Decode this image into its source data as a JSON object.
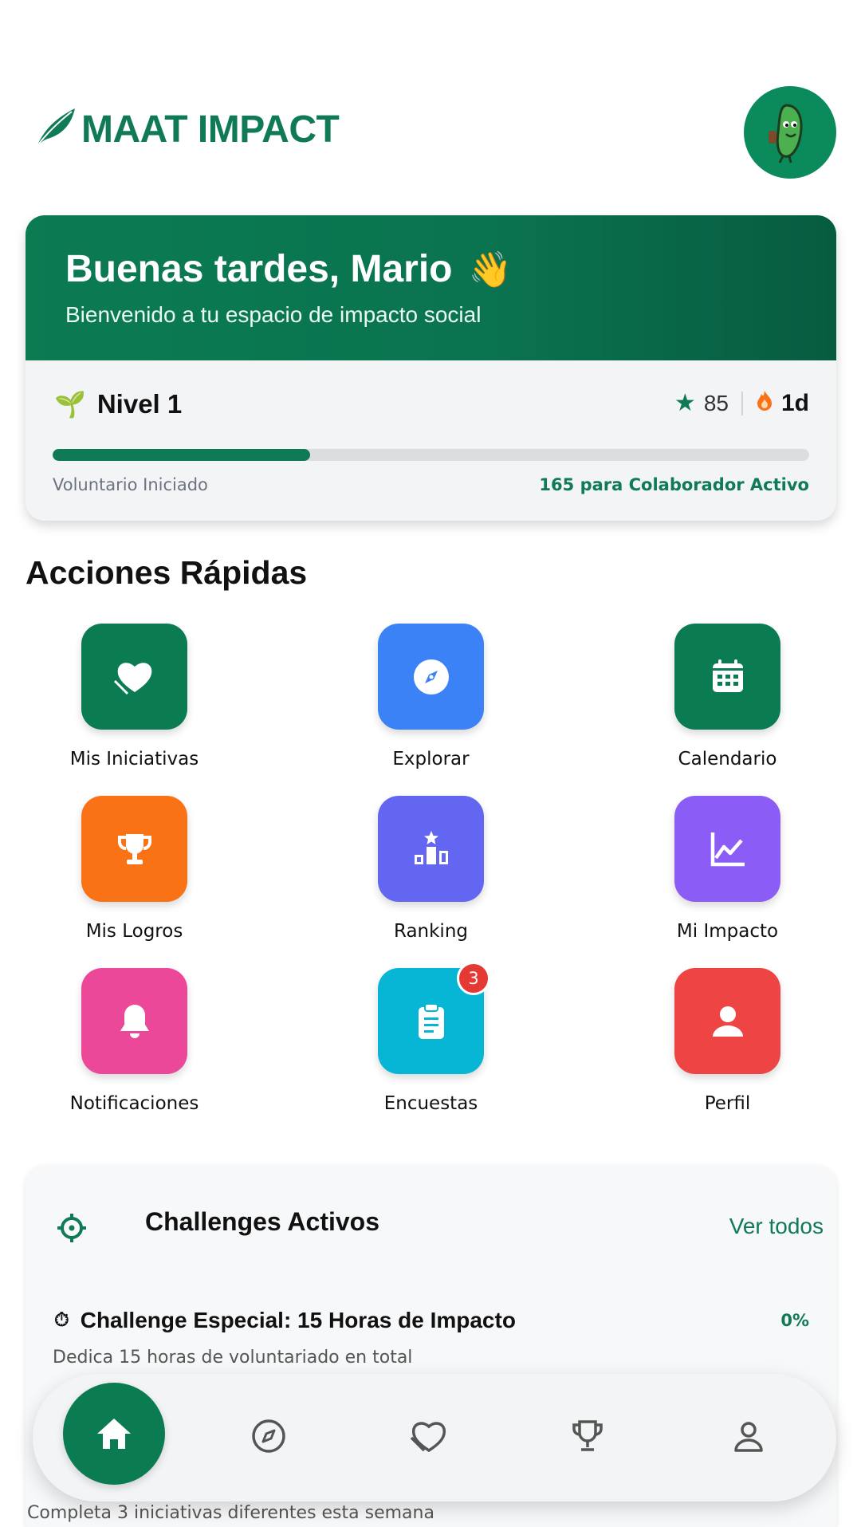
{
  "brand": {
    "name": "MAAT IMPACT",
    "color": "#0f7a55"
  },
  "header": {
    "logo_icon": "leaf-icon",
    "avatar_icon": "mascot-avatar"
  },
  "welcome": {
    "greeting": "Buenas tardes, Mario",
    "wave": "👋",
    "subtitle": "Bienvenido a tu espacio de impacto social"
  },
  "level": {
    "label": "Nivel 1",
    "icon": "🌱",
    "points": "85",
    "streak": "1d",
    "progress": 0.34,
    "current_title": "Voluntario Iniciado",
    "next_text": "165 para Colaborador Activo"
  },
  "quick_actions": {
    "title": "Acciones Rápidas",
    "items": [
      {
        "label": "Mis Iniciativas",
        "icon": "heart-hand-icon",
        "color": "#0b7b52"
      },
      {
        "label": "Explorar",
        "icon": "compass-icon",
        "color": "#3b82f6"
      },
      {
        "label": "Calendario",
        "icon": "calendar-icon",
        "color": "#0b7b52"
      },
      {
        "label": "Mis Logros",
        "icon": "trophy-icon",
        "color": "#f97316"
      },
      {
        "label": "Ranking",
        "icon": "ranking-icon",
        "color": "#6366f1"
      },
      {
        "label": "Mi Impacto",
        "icon": "chart-line-icon",
        "color": "#8b5cf6"
      },
      {
        "label": "Notificaciones",
        "icon": "bell-icon",
        "color": "#ec4899"
      },
      {
        "label": "Encuestas",
        "icon": "clipboard-icon",
        "color": "#06b6d4",
        "badge": "3"
      },
      {
        "label": "Perfil",
        "icon": "user-icon",
        "color": "#ef4444"
      }
    ]
  },
  "challenges": {
    "title": "Challenges Activos",
    "see_all": "Ver todos",
    "items": [
      {
        "title": "Challenge Especial: 15 Horas de Impacto",
        "percent": "0%",
        "description": "Dedica 15 horas de voluntariado en total",
        "icon": "⏱"
      },
      {
        "description": "Completa 3 iniciativas diferentes esta semana"
      }
    ]
  },
  "bottom_nav": {
    "items": [
      "home-icon",
      "compass-icon",
      "heart-hand-icon",
      "trophy-icon",
      "user-icon"
    ]
  }
}
